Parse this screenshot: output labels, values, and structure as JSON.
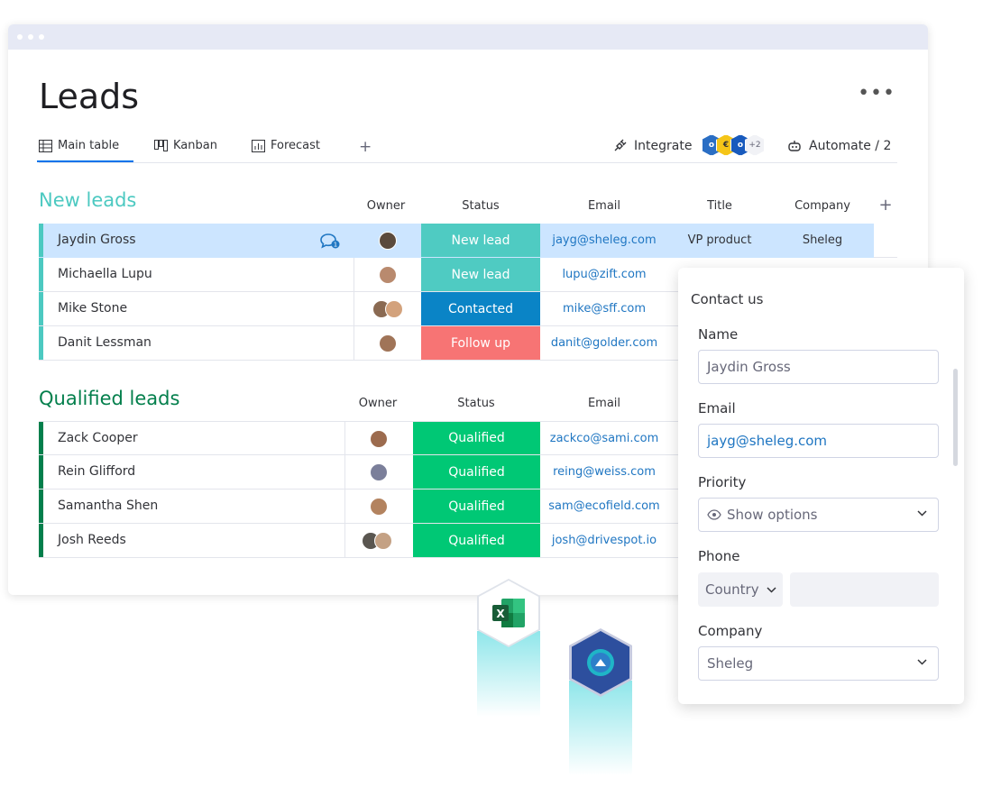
{
  "page": {
    "title": "Leads",
    "more_label": "•••"
  },
  "toolbar": {
    "tabs": [
      {
        "label": "Main table",
        "icon": "table-icon"
      },
      {
        "label": "Kanban",
        "icon": "kanban-icon"
      },
      {
        "label": "Forecast",
        "icon": "chart-icon"
      }
    ],
    "add_tab": "+",
    "integrate_label": "Integrate",
    "integrations_more": "+2",
    "automate_label": "Automate / 2"
  },
  "new_leads": {
    "title": "New leads",
    "color": "#4cc9c1",
    "columns": {
      "owner": "Owner",
      "status": "Status",
      "email": "Email",
      "title": "Title",
      "company": "Company",
      "add": "+"
    },
    "rows": [
      {
        "name": "Jaydin Gross",
        "status": "New lead",
        "email": "jayg@sheleg.com",
        "title": "VP product",
        "company": "Sheleg"
      },
      {
        "name": "Michaella Lupu",
        "status": "New lead",
        "email": "lupu@zift.com"
      },
      {
        "name": "Mike Stone",
        "status": "Contacted",
        "email": "mike@sff.com"
      },
      {
        "name": "Danit Lessman",
        "status": "Follow up",
        "email": "danit@golder.com"
      }
    ]
  },
  "qualified_leads": {
    "title": "Qualified leads",
    "color": "#037f4c",
    "columns": {
      "owner": "Owner",
      "status": "Status",
      "email": "Email"
    },
    "rows": [
      {
        "name": "Zack Cooper",
        "status": "Qualified",
        "email": "zackco@sami.com"
      },
      {
        "name": "Rein Glifford",
        "status": "Qualified",
        "email": "reing@weiss.com"
      },
      {
        "name": "Samantha Shen",
        "status": "Qualified",
        "email": "sam@ecofield.com"
      },
      {
        "name": "Josh Reeds",
        "status": "Qualified",
        "email": "josh@drivespot.io"
      }
    ]
  },
  "status_colors": {
    "New lead": "#4fcbc2",
    "Contacted": "#0a84c6",
    "Follow up": "#f77474",
    "Qualified": "#00c875"
  },
  "integrations_bottom": {
    "excel_letter": "X"
  },
  "contact_form": {
    "title": "Contact us",
    "name_label": "Name",
    "name_value": "Jaydin Gross",
    "email_label": "Email",
    "email_value": "jayg@sheleg.com",
    "priority_label": "Priority",
    "priority_placeholder": "Show options",
    "phone_label": "Phone",
    "country_label": "Country",
    "company_label": "Company",
    "company_value": "Sheleg"
  }
}
